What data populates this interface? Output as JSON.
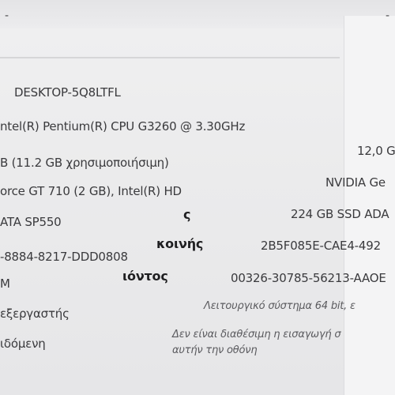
{
  "corner_left": "-",
  "corner_right": "-",
  "left_column": {
    "device_name": "DESKTOP-5Q8LTFL",
    "processor": "ntel(R) Pentium(R) CPU G3260 @ 3.30GHz",
    "ram": "B (11.2 GB χρησιμοποιήσιμη)",
    "graphics": "orce GT 710 (2 GB), Intel(R) HD",
    "storage": "ATA SP550",
    "device_id": "-8884-8217-DDD0808",
    "product_id": "M",
    "system_type": "εξεργαστής",
    "pen_touch": "ιδόμενη"
  },
  "labels": {
    "label_1": "ς",
    "label_2": "κοινής",
    "label_3": "ιόντος"
  },
  "right_column": {
    "ram_value": "12,0 G",
    "graphics_value": "NVIDIA Ge",
    "storage_value": "224 GB SSD ADA",
    "device_id_value": "2B5F085E-CAE4-492",
    "product_id_value": "00326-30785-56213-AAOE",
    "system_type_value": "Λειτουργικό σύστημα 64 bit, ε",
    "pen_touch_value_1": "Δεν είναι διαθέσιμη η εισαγωγή σ",
    "pen_touch_value_2": "αυτήν την οθόνη"
  }
}
